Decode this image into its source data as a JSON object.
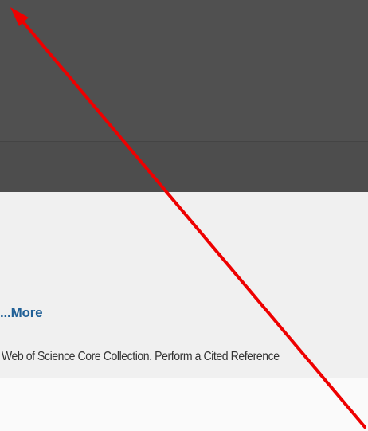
{
  "content": {
    "more_link": "...More",
    "description": "n Web of Science Core Collection. Perform a Cited Reference"
  },
  "annotation": {
    "arrow_color": "#ee0000",
    "arrow_icon": "red-arrow-icon"
  },
  "colors": {
    "header": "#505050",
    "sub_header": "#4d4d4d",
    "content_background": "#f0f0f0",
    "link": "#1f5f96"
  }
}
